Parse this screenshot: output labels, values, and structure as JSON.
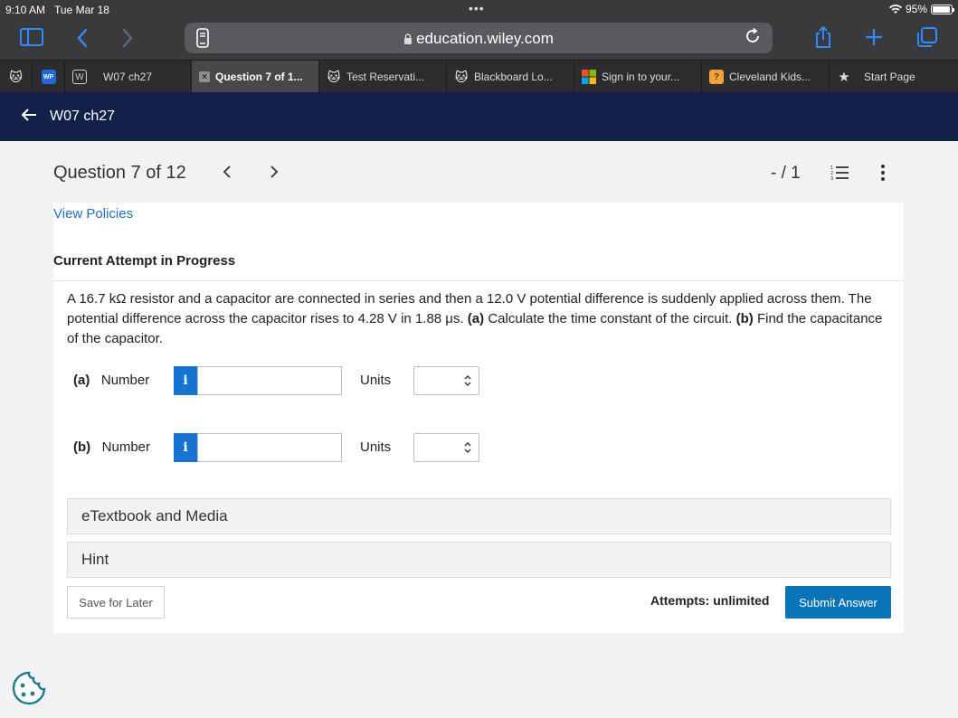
{
  "status_bar": {
    "time": "9:10 AM",
    "date": "Tue Mar 18",
    "battery": "95%",
    "battery_level": 0.95
  },
  "browser": {
    "url": "education.wiley.com",
    "accent_color": "#2f8cff",
    "tabs": [
      {
        "label": "",
        "icon": "cougar-icon",
        "active": false
      },
      {
        "label": "",
        "icon": "wileyplus-icon",
        "active": false
      },
      {
        "label": "W07 ch27",
        "icon": "w-icon",
        "active": false
      },
      {
        "label": "Question 7 of 1...",
        "icon": "close-tab-icon",
        "active": true
      },
      {
        "label": "Test Reservati...",
        "icon": "cougar-icon",
        "active": false
      },
      {
        "label": "Blackboard Lo...",
        "icon": "cougar-icon",
        "active": false
      },
      {
        "label": "Sign in to your...",
        "icon": "microsoft-icon",
        "active": false
      },
      {
        "label": "Cleveland Kids...",
        "icon": "bookmark-orange-icon",
        "active": false
      },
      {
        "label": "Start Page",
        "icon": "star-icon",
        "active": false
      }
    ]
  },
  "header": {
    "title": "W07 ch27",
    "bg_color": "#132148"
  },
  "question": {
    "title": "Question 7 of 12",
    "score": "- / 1",
    "view_policies": "View Policies",
    "attempt_status": "Current Attempt in Progress",
    "problem_text_1": "A 16.7 kΩ resistor and a capacitor are connected in series and then a 12.0 V potential difference is suddenly applied across them. The potential difference across the capacitor rises to 4.28 V in 1.88 μs.",
    "part_a_marker": "(a)",
    "part_a_text": "Calculate the time constant of the circuit.",
    "part_b_marker": "(b)",
    "part_b_text": "Find the capacitance of the capacitor.",
    "answers": [
      {
        "part": "(a)",
        "number_label": "Number",
        "number_value": "",
        "units_label": "Units",
        "units_value": ""
      },
      {
        "part": "(b)",
        "number_label": "Number",
        "number_value": "",
        "units_label": "Units",
        "units_value": ""
      }
    ],
    "etextbook": "eTextbook and Media",
    "hint": "Hint",
    "save_label": "Save for Later",
    "attempts": "Attempts: unlimited",
    "submit_label": "Submit Answer",
    "info_glyph": "i"
  }
}
